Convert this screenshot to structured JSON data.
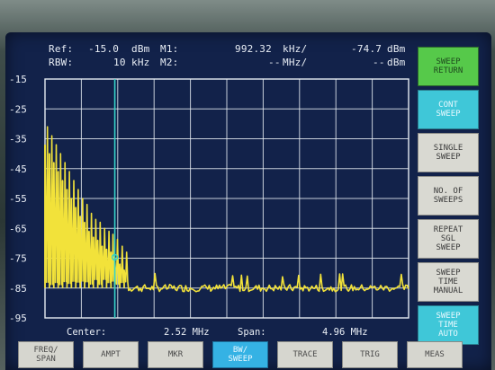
{
  "header": {
    "ref_label": "Ref:",
    "ref_value": "-15.0",
    "ref_unit": "dBm",
    "m1_label": "M1:",
    "m1_freq": "992.32",
    "m1_freq_unit": "kHz/",
    "m1_level": "-74.7",
    "m1_level_unit": "dBm",
    "rbw_label": "RBW:",
    "rbw_value": "10",
    "rbw_unit": "kHz",
    "m2_label": "M2:",
    "m2_freq": "--",
    "m2_freq_unit": "MHz/",
    "m2_level": "--",
    "m2_level_unit": "dBm"
  },
  "y_axis": [
    "-15",
    "-25",
    "-35",
    "-45",
    "-55",
    "-65",
    "-75",
    "-85",
    "-95"
  ],
  "footer": {
    "center_label": "Center:",
    "center_value": "2.52 MHz",
    "span_label": "Span:",
    "span_value": "4.96 MHz"
  },
  "softkeys": [
    {
      "lines": [
        "SWEEP",
        "RETURN"
      ],
      "style": "green"
    },
    {
      "lines": [
        "CONT",
        "SWEEP"
      ],
      "style": "cyan"
    },
    {
      "lines": [
        "SINGLE",
        "SWEEP"
      ],
      "style": "normal"
    },
    {
      "lines": [
        "NO. OF",
        "SWEEPS"
      ],
      "style": "normal"
    },
    {
      "lines": [
        "REPEAT",
        "SGL",
        "SWEEP"
      ],
      "style": "normal"
    },
    {
      "lines": [
        "SWEEP",
        "TIME",
        "MANUAL"
      ],
      "style": "normal"
    },
    {
      "lines": [
        "SWEEP",
        "TIME",
        "AUTO"
      ],
      "style": "cyan"
    }
  ],
  "menu": [
    {
      "lines": [
        "FREQ/",
        "SPAN"
      ],
      "active": false
    },
    {
      "lines": [
        "AMPT"
      ],
      "active": false
    },
    {
      "lines": [
        "MKR"
      ],
      "active": false
    },
    {
      "lines": [
        "BW/",
        "SWEEP"
      ],
      "active": true
    },
    {
      "lines": [
        "TRACE"
      ],
      "active": false
    },
    {
      "lines": [
        "TRIG"
      ],
      "active": false
    },
    {
      "lines": [
        "MEAS"
      ],
      "active": false
    }
  ],
  "colors": {
    "trace": "#f2e23a",
    "marker": "#35d3c8",
    "grid": "#e6ecf2",
    "screen": "#12224a"
  },
  "chart_data": {
    "type": "line",
    "x_unit": "MHz",
    "y_unit": "dBm",
    "xlim": [
      0.04,
      5.0
    ],
    "ylim": [
      -95,
      -15
    ],
    "grid": true,
    "marker_m1": {
      "x": 0.99232,
      "y": -74.7
    },
    "peaks": [
      {
        "x": 0.04,
        "y": -37
      },
      {
        "x": 0.1,
        "y": -40
      },
      {
        "x": 0.16,
        "y": -43
      },
      {
        "x": 0.22,
        "y": -46
      },
      {
        "x": 0.28,
        "y": -49
      },
      {
        "x": 0.34,
        "y": -52
      },
      {
        "x": 0.4,
        "y": -55
      },
      {
        "x": 0.46,
        "y": -58
      },
      {
        "x": 0.52,
        "y": -61
      },
      {
        "x": 0.58,
        "y": -63
      },
      {
        "x": 0.64,
        "y": -66
      },
      {
        "x": 0.7,
        "y": -68
      },
      {
        "x": 0.76,
        "y": -69
      },
      {
        "x": 0.82,
        "y": -71
      },
      {
        "x": 0.88,
        "y": -72
      },
      {
        "x": 0.94,
        "y": -73
      },
      {
        "x": 0.99,
        "y": -74.7
      },
      {
        "x": 1.06,
        "y": -77
      },
      {
        "x": 1.12,
        "y": -79
      }
    ],
    "noise_floor": -85
  }
}
